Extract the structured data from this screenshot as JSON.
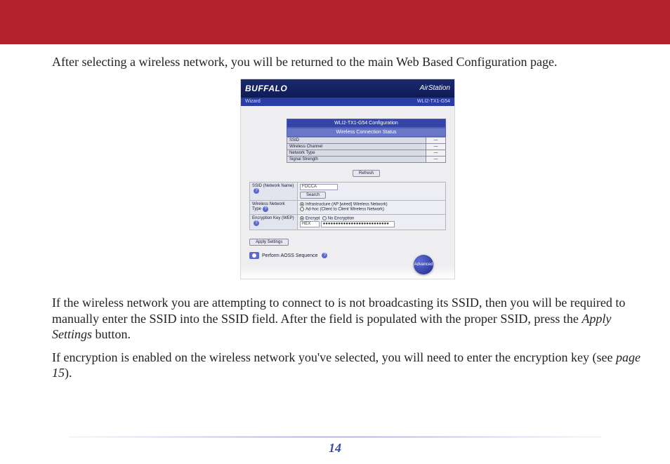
{
  "header": {
    "band_color": "#b4222c"
  },
  "body": {
    "para1": "After selecting a wireless network, you will be returned to the main Web Based Configuration page.",
    "para2_a": "If the wireless network you are attempting to connect to is not broadcasting its SSID, then you will be required to manually enter the SSID into the SSID field.  After the field is populated with the proper SSID, press the ",
    "para2_apply": "Apply Settings",
    "para2_b": " button.",
    "para3_a": "If encryption is enabled on the wireless network you've selected, you will need to enter the encryption key (see ",
    "para3_ref": "page 15",
    "para3_b": ")."
  },
  "screenshot": {
    "brand": "BUFFALO",
    "brand_right": "AirStation",
    "sub_left": "Wizard",
    "sub_right": "WLI2-TX1-G54",
    "cfg_title": "WLI2-TX1-G54 Configuration",
    "status_title": "Wireless Connection Status",
    "status_rows": [
      {
        "label": "SSID",
        "value": "—"
      },
      {
        "label": "Wireless Channel",
        "value": "—"
      },
      {
        "label": "Network Type",
        "value": "—"
      },
      {
        "label": "Signal Strength",
        "value": "—"
      }
    ],
    "refresh": "Refresh",
    "form": {
      "ssid_label": "SSID (Network Name)",
      "ssid_value": "FOCCA",
      "search": "Search",
      "net_type_label": "Wireless Network Type",
      "net_type_opt1": "Infrastructure (AP [wired] Wireless Network)",
      "net_type_opt2": "Ad-hoc (Client to Client Wireless Network)",
      "enc_label": "Encryption Key (WEP)",
      "enc_opt1": "Encrypt",
      "enc_opt2": "No Encryption",
      "enc_mode": "HEX",
      "enc_value": "●●●●●●●●●●●●●●●●●●●●●●●●●●"
    },
    "apply": "Apply Settings",
    "aoss": "Perform AOSS Sequence",
    "advanced": "Advanced"
  },
  "footer": {
    "page_number": "14"
  }
}
